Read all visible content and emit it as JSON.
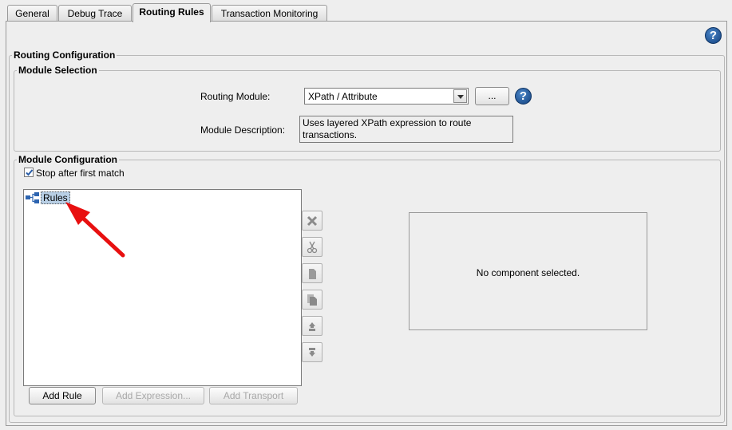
{
  "tabs": [
    {
      "label": "General",
      "active": false
    },
    {
      "label": "Debug Trace",
      "active": false
    },
    {
      "label": "Routing Rules",
      "active": true
    },
    {
      "label": "Transaction Monitoring",
      "active": false
    }
  ],
  "routing_configuration": {
    "title": "Routing Configuration",
    "module_selection": {
      "title": "Module Selection",
      "routing_module_label": "Routing Module:",
      "routing_module_value": "XPath / Attribute",
      "browse_label": "...",
      "description_label": "Module Description:",
      "description_value": "Uses layered XPath expression to route transactions."
    },
    "module_configuration": {
      "title": "Module Configuration",
      "stop_after_first_match": {
        "label": "Stop after first match",
        "checked": true
      },
      "tree_root": "Rules",
      "detail_text": "No component selected.",
      "buttons": {
        "add_rule": "Add Rule",
        "add_expression": "Add Expression...",
        "add_transport": "Add Transport"
      }
    }
  },
  "icons": {
    "help": "question-mark-icon",
    "delete": "x-icon",
    "cut": "scissors-icon",
    "copy": "copy-icon",
    "paste": "paste-icon",
    "move_up": "move-up-icon",
    "move_down": "move-down-icon",
    "tree_root": "tree-structure-icon"
  },
  "colors": {
    "selection": "#b8cfe5",
    "help_icon": "#1a4f8f",
    "annotation_arrow": "#e81010"
  }
}
